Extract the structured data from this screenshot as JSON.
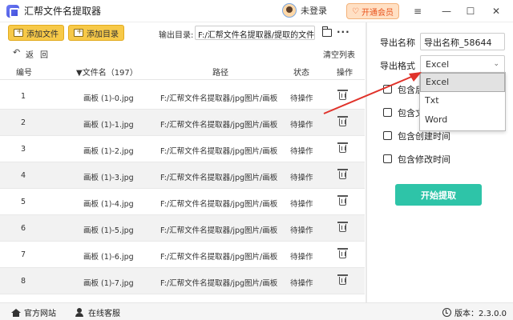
{
  "app": {
    "title": "汇帮文件名提取器"
  },
  "header": {
    "login_text": "未登录",
    "vip_label": "开通会员"
  },
  "toolbar": {
    "add_file": "添加文件",
    "add_folder": "添加目录",
    "output_label": "输出目录:",
    "output_path": "F:/汇帮文件名提取器/提取的文件名"
  },
  "subbar": {
    "back": "返",
    "back2": "回",
    "clear_list": "清空列表"
  },
  "table": {
    "headers": {
      "index": "编号",
      "filename": "▼文件名（197）",
      "path": "路径",
      "status": "状态",
      "action": "操作"
    },
    "rows": [
      {
        "index": "1",
        "filename": "画板 (1)-0.jpg",
        "path": "F:/汇帮文件名提取器/jpg图片/画板 (1)-0",
        "status": "待操作"
      },
      {
        "index": "2",
        "filename": "画板 (1)-1.jpg",
        "path": "F:/汇帮文件名提取器/jpg图片/画板 (1)-1",
        "status": "待操作"
      },
      {
        "index": "3",
        "filename": "画板 (1)-2.jpg",
        "path": "F:/汇帮文件名提取器/jpg图片/画板 (1)-2",
        "status": "待操作"
      },
      {
        "index": "4",
        "filename": "画板 (1)-3.jpg",
        "path": "F:/汇帮文件名提取器/jpg图片/画板 (1)-3",
        "status": "待操作"
      },
      {
        "index": "5",
        "filename": "画板 (1)-4.jpg",
        "path": "F:/汇帮文件名提取器/jpg图片/画板 (1)-4",
        "status": "待操作"
      },
      {
        "index": "6",
        "filename": "画板 (1)-5.jpg",
        "path": "F:/汇帮文件名提取器/jpg图片/画板 (1)-5",
        "status": "待操作"
      },
      {
        "index": "7",
        "filename": "画板 (1)-6.jpg",
        "path": "F:/汇帮文件名提取器/jpg图片/画板 (1)-6",
        "status": "待操作"
      },
      {
        "index": "8",
        "filename": "画板 (1)-7.jpg",
        "path": "F:/汇帮文件名提取器/jpg图片/画板 (1)-7",
        "status": "待操作"
      }
    ]
  },
  "panel": {
    "export_name_label": "导出名称",
    "export_name_value": "导出名称_58644",
    "export_format_label": "导出格式",
    "export_format_value": "Excel",
    "format_options": [
      "Excel",
      "Txt",
      "Word"
    ],
    "checkboxes": [
      "包含后",
      "包含文",
      "包含创建时间",
      "包含修改时间"
    ],
    "start_button": "开始提取"
  },
  "statusbar": {
    "website": "官方网站",
    "support": "在线客服",
    "version": "版本：2.3.0.0"
  },
  "colors": {
    "accent": "#2ec4a8",
    "toolbar_button": "#f7c948",
    "vip": "#e8531c",
    "arrow": "#e0322a"
  }
}
